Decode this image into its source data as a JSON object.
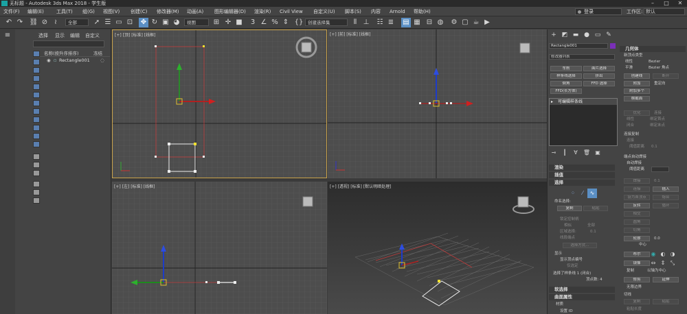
{
  "window": {
    "title": "无标题 - Autodesk 3ds Max 2018 - 学生版"
  },
  "menu": [
    "文件(F)",
    "编辑(E)",
    "工具(T)",
    "组(G)",
    "视图(V)",
    "创建(C)",
    "修改器(M)",
    "动画(A)",
    "图形编辑器(D)",
    "渲染(R)",
    "Civil View",
    "自定义(U)",
    "脚本(S)",
    "内容",
    "Arnold",
    "帮助(H)"
  ],
  "login": "登录",
  "workspace_label": "工作区:",
  "workspace_value": "默认",
  "toolbar": {
    "filter": "全部",
    "coordsys": "视图",
    "selset": "创建选择集"
  },
  "scene": {
    "tabs": [
      "选择",
      "显示",
      "编辑",
      "自定义"
    ],
    "col_name": "名称(按升序排序)",
    "col_freeze": "冻结",
    "object": "Rectangle001"
  },
  "viewports": {
    "top": "[+] [顶] [标准] [线框]",
    "front": "[+] [前] [标准] [线框]",
    "left": "[+] [左] [标准] [线框]",
    "persp": "[+] [透视] [标准] [默认明暗处理]"
  },
  "cmd": {
    "object_name": "Rectangle001",
    "modifier_list": "修改器列表",
    "buttons": [
      "车削",
      "面片选择",
      "样条线选择",
      "挤出",
      "倒角",
      "FFD 选择",
      "FFD(长方体)"
    ],
    "stack_item": "可编辑样条线",
    "rollouts": [
      "渲染",
      "插值",
      "选择"
    ],
    "named_sel": "命名选择:",
    "copy": "复制",
    "paste": "粘贴",
    "lock_handles": "锁定控制柄",
    "similar": "相似",
    "all": "全部",
    "area_sel": "区域选择:",
    "area_val": "0.1",
    "seg_end": "线段端点",
    "select_by": "选择方式...",
    "display": "显示",
    "show_vertex_num": "显示顶点编号",
    "selected_only": "仅选定",
    "status": "选择了样条线 1 (闭合)",
    "vertex_count": "顶点数: 4",
    "soft_sel": "软选择",
    "surface": "曲面属性",
    "material": "材质",
    "set_id": "设置 ID"
  },
  "roll": {
    "title": "几何体",
    "new_vertex_type": "新顶点类型",
    "linear": "线性",
    "bezier": "Bezier",
    "smooth": "平滑",
    "bezier_corner": "Bezier 角点",
    "create_line": "创建线",
    "break": "断开",
    "attach": "附加",
    "reorient": "重定向",
    "attach_mult": "附加多个",
    "cross_section": "横截面",
    "optimize": "优化",
    "connect": "连接",
    "linear2": "线性",
    "bind_first": "绑定首点",
    "closed": "闭合",
    "bind_last": "绑定末点",
    "connect_copy": "连接复制",
    "threshold": "阈值距离",
    "threshold_val": "0.1",
    "endpoint_auto": "端点自动焊接",
    "auto_weld": "自动焊接",
    "weld_thresh": "阈值距离",
    "weld": "焊接",
    "weld_val": "0.1",
    "connect2": "连接",
    "insert": "插入",
    "make_first": "设为首顶点",
    "fuse": "熔合",
    "reverse": "反转",
    "cycle": "循环",
    "intersect": "相交",
    "fillet": "圆角",
    "chamfer": "切角",
    "outline": "轮廓",
    "outline_val": "0.0",
    "center": "中心",
    "boolean": "布尔",
    "mirror": "镜像",
    "copy2": "复制",
    "mirror_axis": "以轴为中心",
    "trim": "修剪",
    "extend": "延伸",
    "infinite": "无限边界",
    "tangent": "切线",
    "copy3": "复制",
    "paste2": "粘贴",
    "paste_len": "粘贴长度"
  },
  "colors": {
    "bg": "#3b3b3b",
    "viewport": "#4d4d4d",
    "active_border": "#c9a24a",
    "accent": "#5b8fc4"
  }
}
